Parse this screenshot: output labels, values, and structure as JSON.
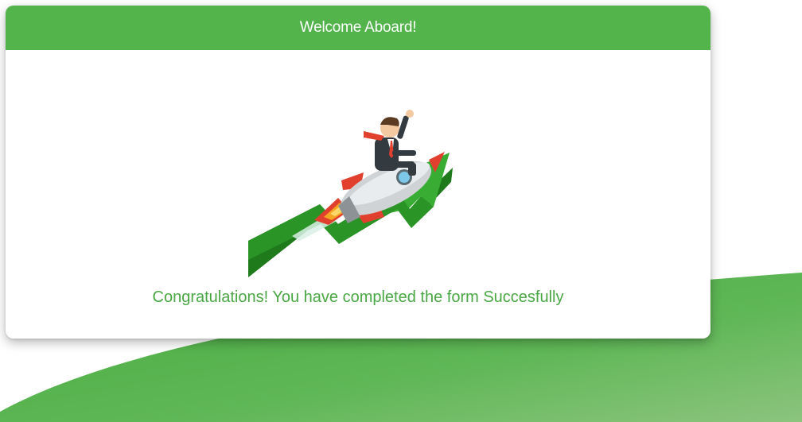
{
  "dialog": {
    "title": "Welcome Aboard!",
    "message": "Congratulations! You have completed the form Succesfully"
  },
  "illustration": {
    "icon": "businessman-riding-rocket-over-growth-arrow"
  },
  "colors": {
    "header": "#52b44b",
    "message_text": "#4aa744",
    "arrow_green": "#2e9e2a",
    "rocket_red": "#e2402f",
    "background_wave": "#5db454"
  }
}
